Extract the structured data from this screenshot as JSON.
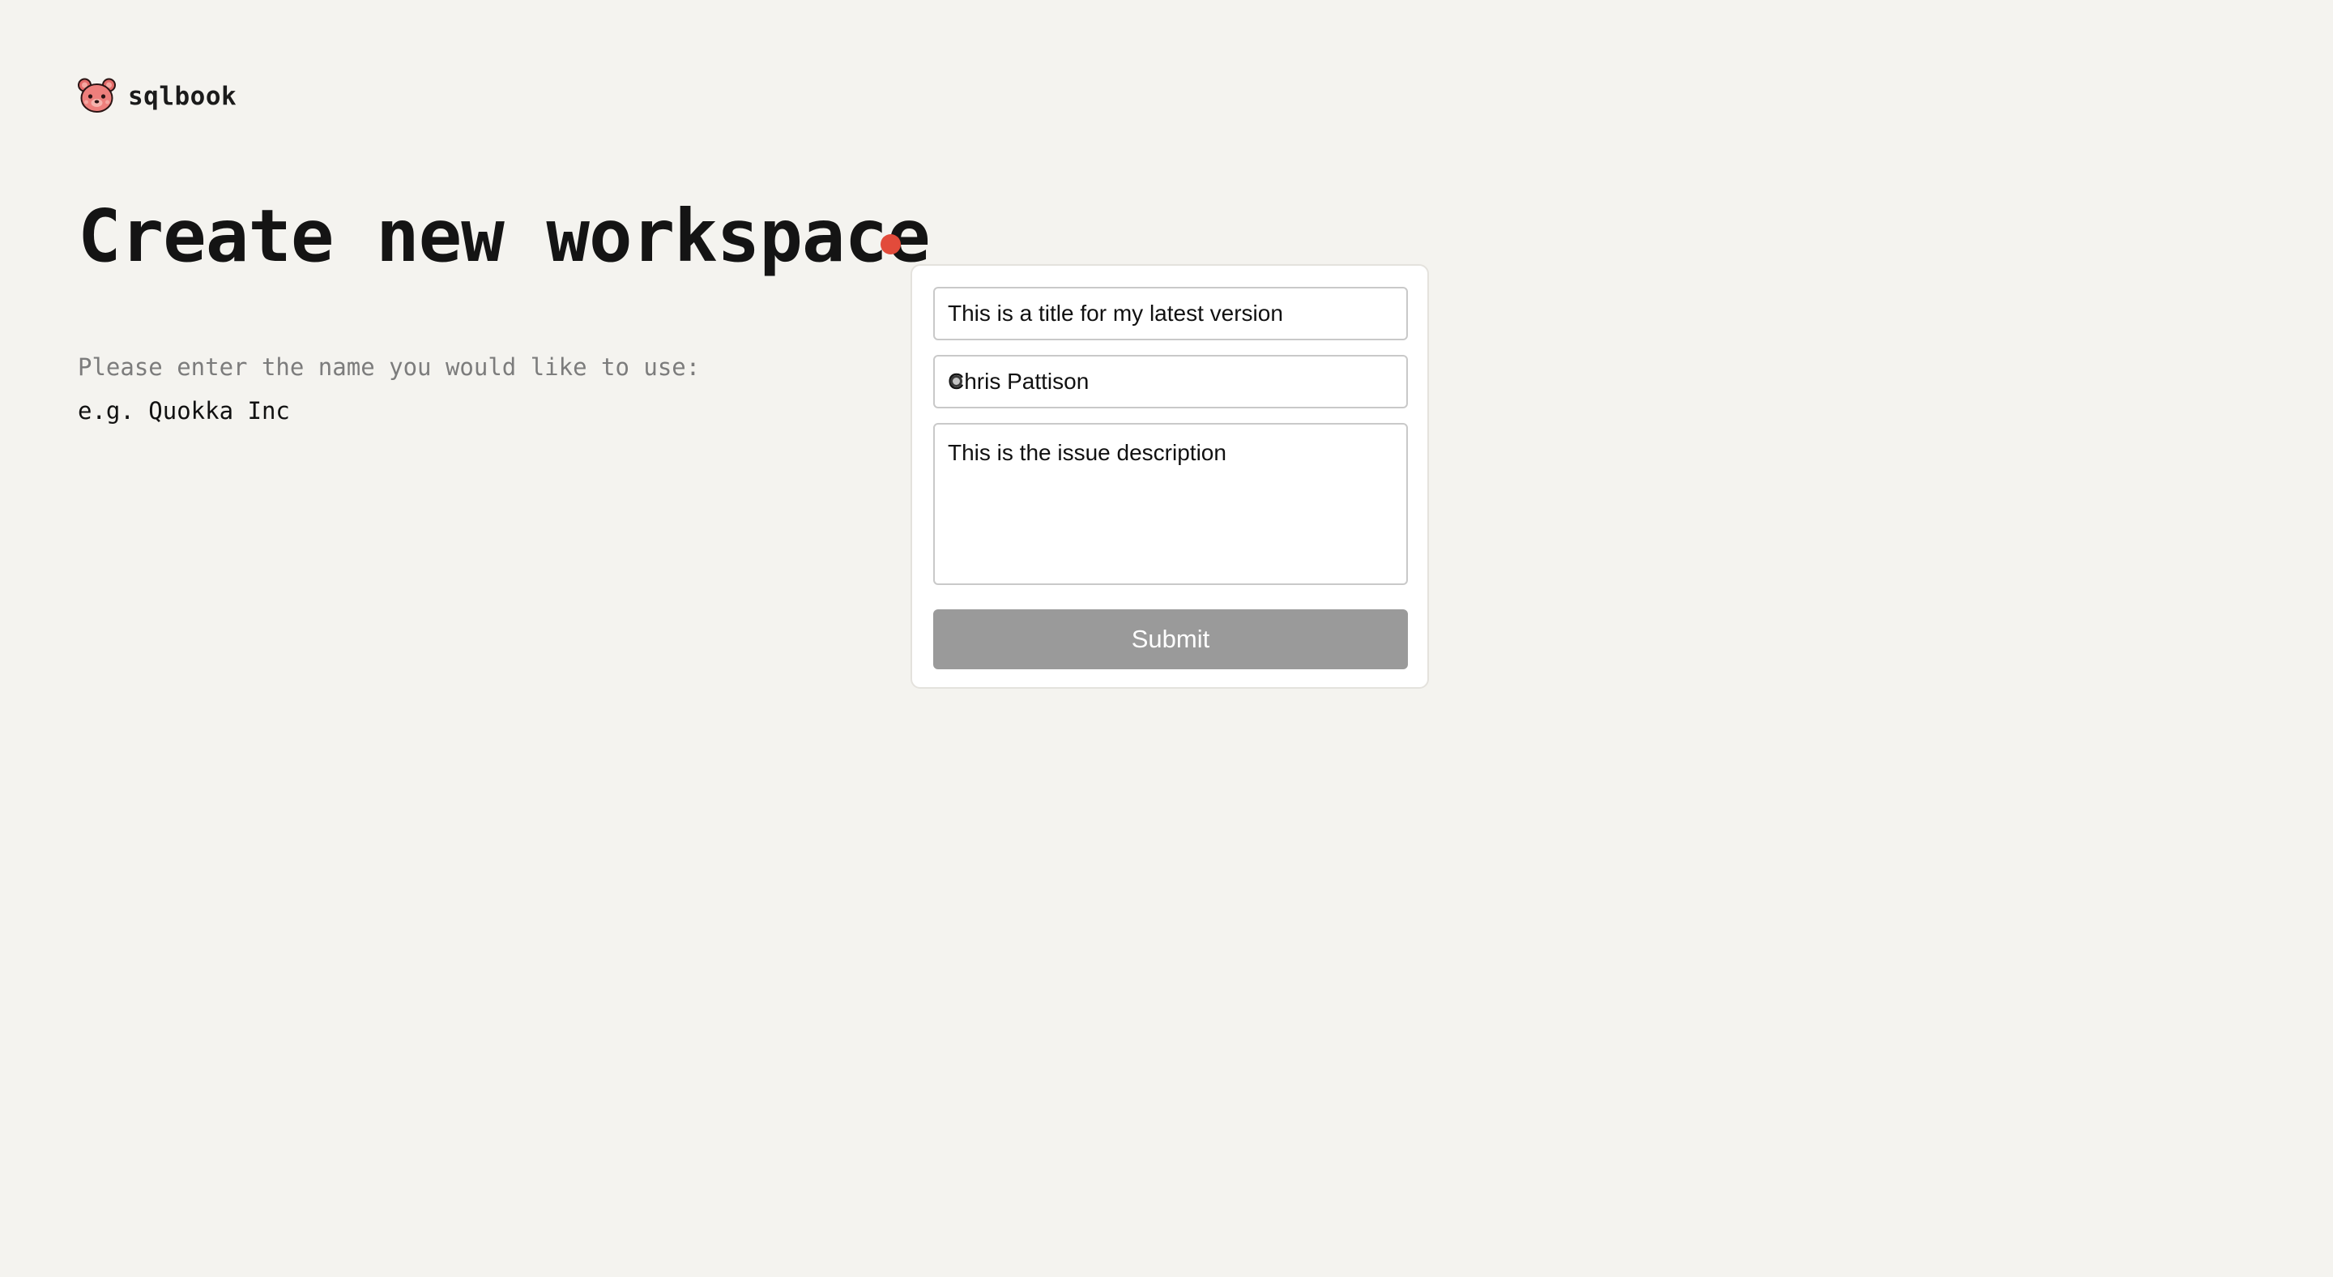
{
  "brand": {
    "name": "sqlbook",
    "logo_icon": "pink-bear-icon"
  },
  "main": {
    "title": "Create new workspace",
    "prompt": "Please enter the name you would like to use:",
    "name_placeholder": "e.g. Quokka Inc",
    "name_value": ""
  },
  "feedback_form": {
    "title_value": "This is a title for my latest version",
    "reporter_value": "Chris Pattison",
    "description_value": "This is the issue description",
    "submit_label": "Submit"
  },
  "colors": {
    "background": "#f4f3ef",
    "accent_dot": "#e24b3b",
    "submit_button": "#9a9a9a"
  }
}
